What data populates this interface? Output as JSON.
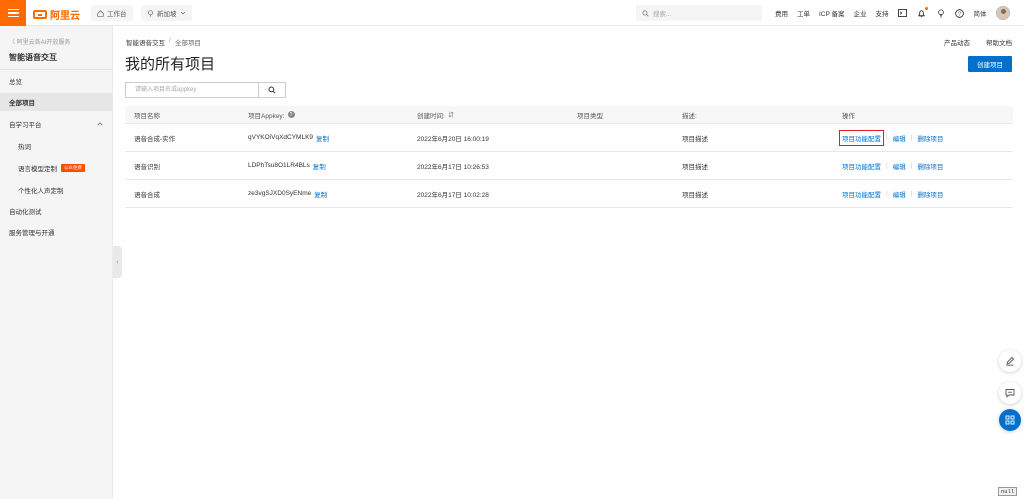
{
  "topbar": {
    "logo_text": "阿里云",
    "workspace_label": "工作台",
    "region_label": "新加坡",
    "search_placeholder": "搜索...",
    "links": [
      "费用",
      "工单",
      "ICP 备案",
      "企业",
      "支持"
    ],
    "lang": "简体",
    "accent": "#ff6a00"
  },
  "sidebar": {
    "back": "〈 阿里云各AI开放服务",
    "title": "智能语音交互",
    "items": [
      {
        "label": "总览"
      },
      {
        "label": "全部项目"
      },
      {
        "label": "自学习平台"
      },
      {
        "label": "热词"
      },
      {
        "label": "语言模型定制",
        "badge": "公众免费"
      },
      {
        "label": "个性化人声定制"
      },
      {
        "label": "自动化测试"
      },
      {
        "label": "服务管理与开通"
      }
    ]
  },
  "main": {
    "breadcrumb": [
      "智能语音交互",
      "/",
      "全部项目"
    ],
    "top_links": [
      "产品动态",
      "帮助文档"
    ],
    "title": "我的所有项目",
    "create_button": "创建项目",
    "search_placeholder": "请输入项目名或appkey",
    "table": {
      "headers": [
        "项目名称",
        "项目Appkey:",
        "创建时间:",
        "项目类型",
        "描述:",
        "操作"
      ],
      "copy_label": "复制",
      "ops": [
        "项目功能配置",
        "编辑",
        "删除项目"
      ],
      "rows": [
        {
          "name": "语音合成-实作",
          "appkey": "qVYKOiVqXdCYMLK9",
          "time": "2022年6月20日 16:00:19",
          "type": "",
          "desc": "项目描述"
        },
        {
          "name": "语音识别",
          "appkey": "LDPhTsu8O1LR4BLs",
          "time": "2022年6月17日 10:26:53",
          "type": "",
          "desc": "项目描述"
        },
        {
          "name": "语音合成",
          "appkey": "ze3vgSJXD0SyENme",
          "time": "2022年6月17日 10:02:28",
          "type": "",
          "desc": "项目描述"
        }
      ]
    }
  },
  "footer": {
    "null_label": "null"
  }
}
